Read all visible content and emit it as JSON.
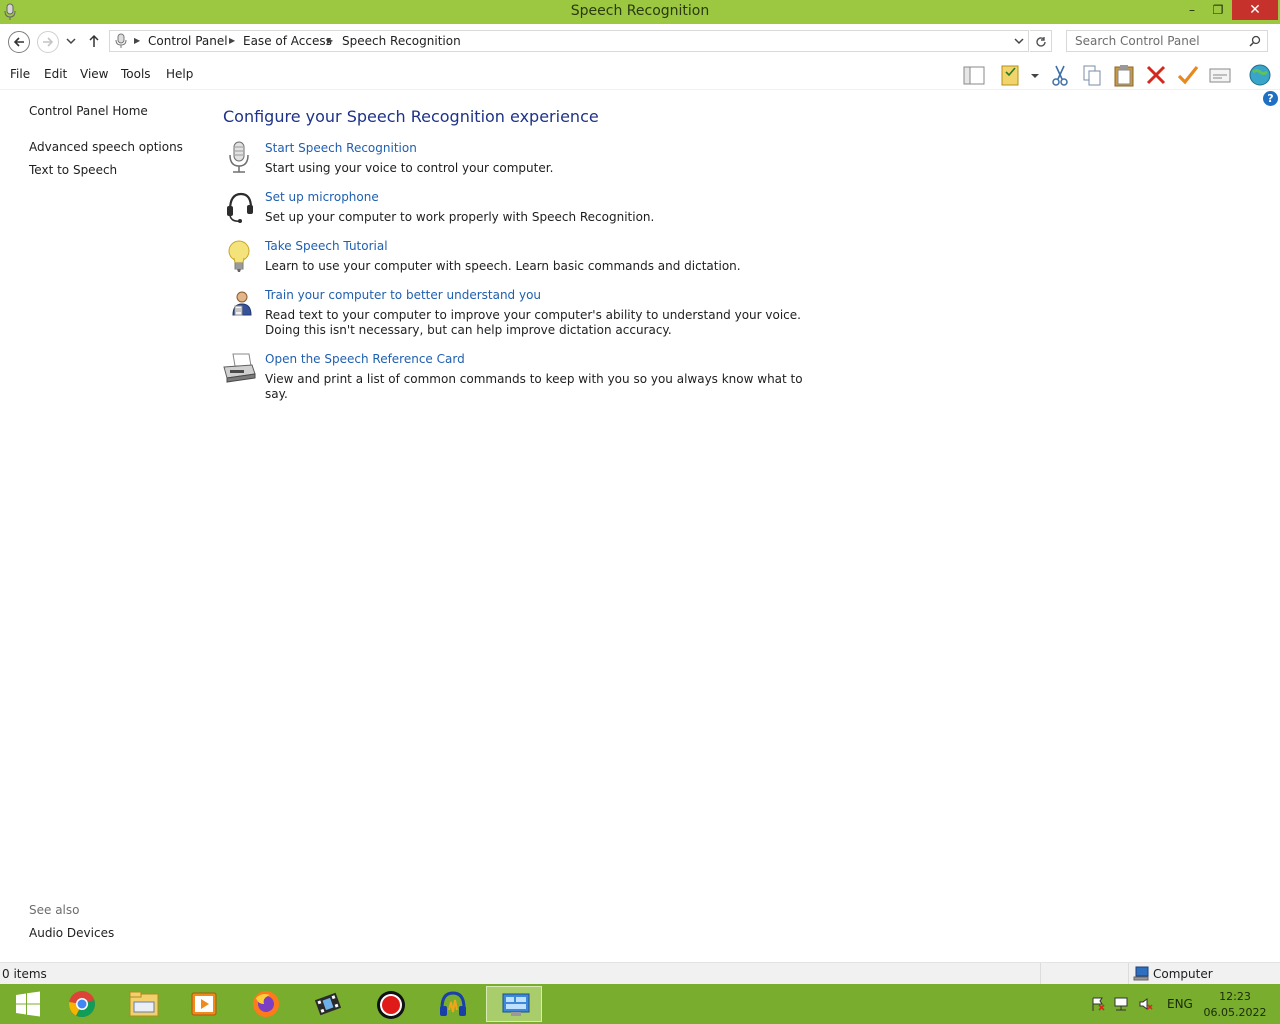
{
  "window": {
    "title": "Speech Recognition",
    "minimize": "–",
    "maximize": "❐",
    "close": "✕"
  },
  "address": {
    "breadcrumbs": [
      "Control Panel",
      "Ease of Access",
      "Speech Recognition"
    ],
    "search_placeholder": "Search Control Panel"
  },
  "menu": [
    "File",
    "Edit",
    "View",
    "Tools",
    "Help"
  ],
  "toolbar_icons": [
    "layout-pane-icon",
    "folder-options-icon",
    "cut-icon",
    "copy-icon",
    "paste-icon",
    "delete-icon",
    "checkmark-icon",
    "properties-icon",
    "globe-icon"
  ],
  "left_pane": {
    "home": "Control Panel Home",
    "links": [
      "Advanced speech options",
      "Text to Speech"
    ],
    "see_also_title": "See also",
    "see_also_links": [
      "Audio Devices"
    ]
  },
  "main": {
    "heading": "Configure your Speech Recognition experience",
    "tasks": [
      {
        "icon": "microphone-icon",
        "link": "Start Speech Recognition",
        "desc": "Start using your voice to control your computer."
      },
      {
        "icon": "headset-icon",
        "link": "Set up microphone",
        "desc": "Set up your computer to work properly with Speech Recognition."
      },
      {
        "icon": "lightbulb-icon",
        "link": "Take Speech Tutorial",
        "desc": "Learn to use your computer with speech.  Learn basic commands and dictation."
      },
      {
        "icon": "user-training-icon",
        "link": "Train your computer to better understand you",
        "desc": "Read text to your computer to improve your computer's ability to understand your voice.  Doing this isn't necessary, but can help improve dictation accuracy."
      },
      {
        "icon": "printer-icon",
        "link": "Open the Speech Reference Card",
        "desc": "View and print a list of common commands to keep with you so you always know what to say."
      }
    ]
  },
  "status": {
    "items": "0 items",
    "location": "Computer"
  },
  "taskbar": {
    "apps": [
      "windows-start-icon",
      "chrome-icon",
      "file-explorer-icon",
      "media-player-icon",
      "firefox-icon",
      "video-editor-icon",
      "record-icon",
      "audio-app-icon",
      "control-panel-icon"
    ],
    "language": "ENG",
    "time": "12:23",
    "date": "06.05.2022"
  },
  "colors": {
    "titlebar": "#9bc741",
    "taskbar": "#78ad2d",
    "heading": "#1e3287",
    "link": "#1f5fb0",
    "close": "#c7312b"
  }
}
